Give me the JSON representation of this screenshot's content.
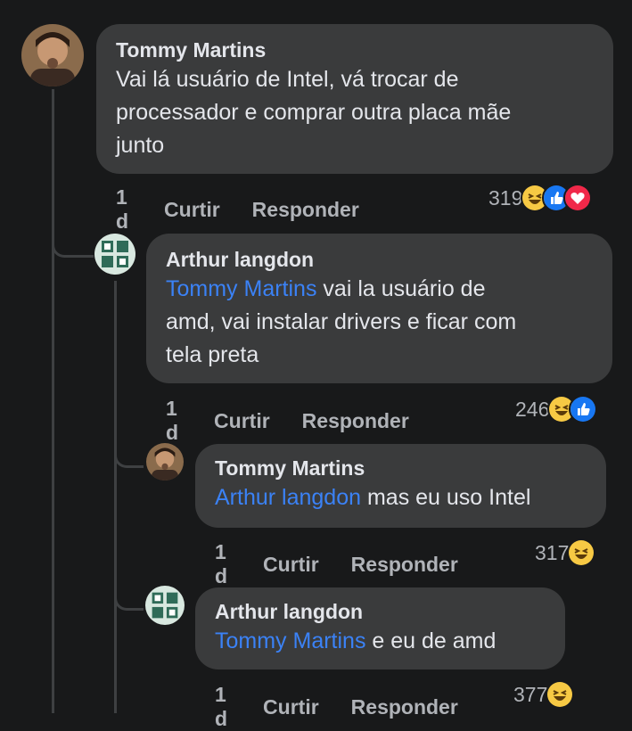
{
  "comments": [
    {
      "author": "Tommy Martins",
      "mention": "",
      "text_lines": [
        "Vai lá usuário de Intel, vá trocar de",
        "processador e comprar outra placa mãe",
        "junto"
      ],
      "time": "1 d",
      "like": "Curtir",
      "reply": "Responder",
      "count": "319",
      "reactions": [
        "haha-icon",
        "like-icon",
        "love-icon"
      ]
    },
    {
      "author": "Arthur langdon",
      "mention": "Tommy Martins",
      "text_first": " vai la usuário de",
      "text_lines": [
        "amd, vai instalar drivers e ficar com",
        "tela preta"
      ],
      "time": "1 d",
      "like": "Curtir",
      "reply": "Responder",
      "count": "246",
      "reactions": [
        "haha-icon",
        "like-icon"
      ]
    },
    {
      "author": "Tommy Martins",
      "mention": "Arthur langdon",
      "text_first": " mas eu uso Intel",
      "time": "1 d",
      "like": "Curtir",
      "reply": "Responder",
      "count": "317",
      "reactions": [
        "haha-icon"
      ]
    },
    {
      "author": "Arthur langdon",
      "mention": "Tommy Martins",
      "text_first": " e eu de amd",
      "time": "1 d",
      "like": "Curtir",
      "reply": "Responder",
      "count": "377",
      "reactions": [
        "haha-icon"
      ]
    }
  ],
  "colors": {
    "background": "#18191a",
    "bubble": "#3a3b3c",
    "mention": "#3b82f6",
    "haha": "#f7c944",
    "like": "#1877f2",
    "love": "#f02849"
  }
}
